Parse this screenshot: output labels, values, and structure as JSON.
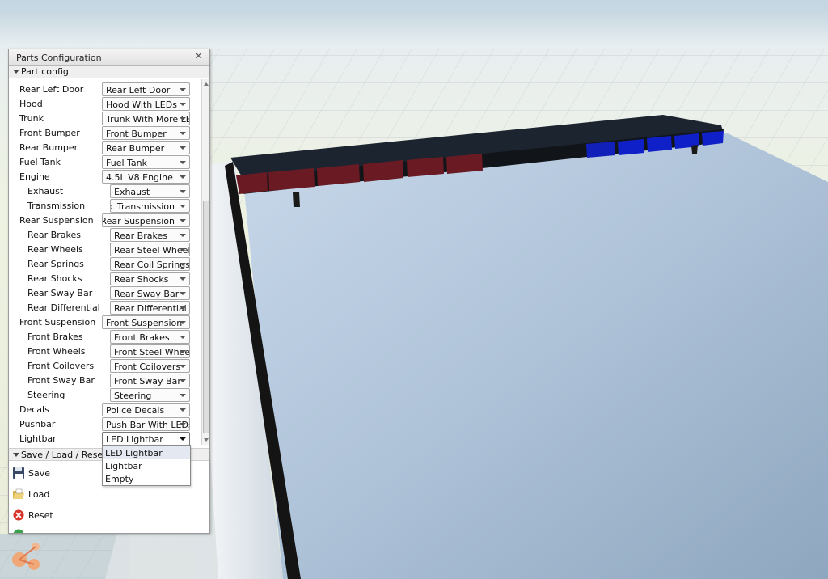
{
  "window": {
    "title": "Parts Configuration",
    "close_glyph": "×"
  },
  "part_config": {
    "section_label": "Part config",
    "rows": [
      {
        "label": "Rear Left Door",
        "value": "Rear Left Door",
        "indent": 0
      },
      {
        "label": "Hood",
        "value": "Hood With LEDs",
        "indent": 0
      },
      {
        "label": "Trunk",
        "value": "Trunk With More LEDs",
        "indent": 0
      },
      {
        "label": "Front Bumper",
        "value": "Front Bumper",
        "indent": 0
      },
      {
        "label": "Rear Bumper",
        "value": "Rear Bumper",
        "indent": 0
      },
      {
        "label": "Fuel Tank",
        "value": "Fuel Tank",
        "indent": 0
      },
      {
        "label": "Engine",
        "value": "4.5L V8 Engine",
        "indent": 0
      },
      {
        "label": "Exhaust",
        "value": "Exhaust",
        "indent": 1
      },
      {
        "label": "Transmission",
        "value": "itic Transmission",
        "indent": 1,
        "clipped": true
      },
      {
        "label": "Rear Suspension",
        "value": "e Rear Suspension",
        "indent": 0,
        "clipped": true
      },
      {
        "label": "Rear Brakes",
        "value": "Rear Brakes",
        "indent": 1
      },
      {
        "label": "Rear Wheels",
        "value": "Rear Steel Wheels",
        "indent": 1
      },
      {
        "label": "Rear Springs",
        "value": "Rear Coil Springs",
        "indent": 1
      },
      {
        "label": "Rear Shocks",
        "value": "Rear Shocks",
        "indent": 1
      },
      {
        "label": "Rear Sway Bar",
        "value": "Rear Sway Bar",
        "indent": 1
      },
      {
        "label": "Rear Differential",
        "value": "Rear Differential",
        "indent": 1
      },
      {
        "label": "Front Suspension",
        "value": "Front Suspension",
        "indent": 0
      },
      {
        "label": "Front Brakes",
        "value": "Front Brakes",
        "indent": 1
      },
      {
        "label": "Front Wheels",
        "value": "Front Steel Wheels",
        "indent": 1
      },
      {
        "label": "Front Coilovers",
        "value": "Front Coilovers",
        "indent": 1
      },
      {
        "label": "Front Sway Bar",
        "value": "Front Sway Bar",
        "indent": 1
      },
      {
        "label": "Steering",
        "value": "Steering",
        "indent": 1
      },
      {
        "label": "Decals",
        "value": "Police Decals",
        "indent": 0
      },
      {
        "label": "Pushbar",
        "value": "Push Bar With LEDs",
        "indent": 0
      },
      {
        "label": "Lightbar",
        "value": "LED Lightbar",
        "indent": 0,
        "open": true
      }
    ]
  },
  "save_load": {
    "section_label": "Save / Load / Reset",
    "save_label": "Save",
    "load_label": "Load",
    "reset_label": "Reset"
  },
  "lightbar_dropdown": {
    "options": [
      "LED Lightbar",
      "Lightbar",
      "Empty"
    ],
    "highlighted": 0
  },
  "icons": {
    "close": "close-icon",
    "save": "floppy-disk-icon",
    "load": "folder-open-icon",
    "reset": "red-x-circle-icon"
  }
}
